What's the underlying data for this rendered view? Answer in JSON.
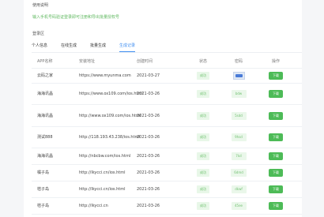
{
  "usage": {
    "title": "使用说明",
    "text": "输入手机号码验证登录即可注册和导出批量授权号"
  },
  "section": {
    "title": "登录区"
  },
  "tabs": [
    {
      "label": "个人信息",
      "active": false
    },
    {
      "label": "在线生成",
      "active": false
    },
    {
      "label": "批量生成",
      "active": false
    },
    {
      "label": "生成记录",
      "active": true
    }
  ],
  "table": {
    "headers": [
      "APP名称",
      "安装地址",
      "创建时间",
      "状态",
      "密码",
      "操作"
    ],
    "rows": [
      {
        "name": "云码之家",
        "url": "https://www.myunma.com",
        "time": "2021-03-27",
        "status": "成功",
        "code": "",
        "code_type": "qr",
        "action": "下载"
      },
      {
        "name": "海海讯晶",
        "url": "https://www.ox109.com/ios.html",
        "time": "2021-03-26",
        "status": "成功",
        "code": "bdw",
        "code_type": "text",
        "action": "下载"
      },
      {
        "name": "海海讯晶",
        "url": "http://www.ox109.com/ios.html",
        "time": "2021-03-26",
        "status": "成功",
        "code": "5sdd",
        "code_type": "text",
        "action": "下载"
      },
      {
        "name": "测试888",
        "url": "http://118.193.43.238/ios.html",
        "time": "2021-03-26",
        "status": "成功",
        "code": "9hsd",
        "code_type": "text",
        "action": "下载"
      },
      {
        "name": "海海讯晶",
        "url": "http://nbcbw.com/ios.html",
        "time": "2021-03-26",
        "status": "成功",
        "code": "7kd",
        "code_type": "text",
        "action": "下载"
      },
      {
        "name": "橘子岛",
        "url": "http://lkycci.cn/ios.html",
        "time": "2021-03-26",
        "status": "成功",
        "code": "6dmd",
        "code_type": "text",
        "action": "下载"
      },
      {
        "name": "桔子岛",
        "url": "http://lkycci.cn/ios.html",
        "time": "2021-03-26",
        "status": "成功",
        "code": "dkwf",
        "code_type": "text",
        "action": "下载"
      },
      {
        "name": "桔子岛",
        "url": "http://lkycci.cn",
        "time": "2021-03-26",
        "status": "成功",
        "code": "45ee",
        "code_type": "text",
        "action": "下载"
      }
    ]
  }
}
